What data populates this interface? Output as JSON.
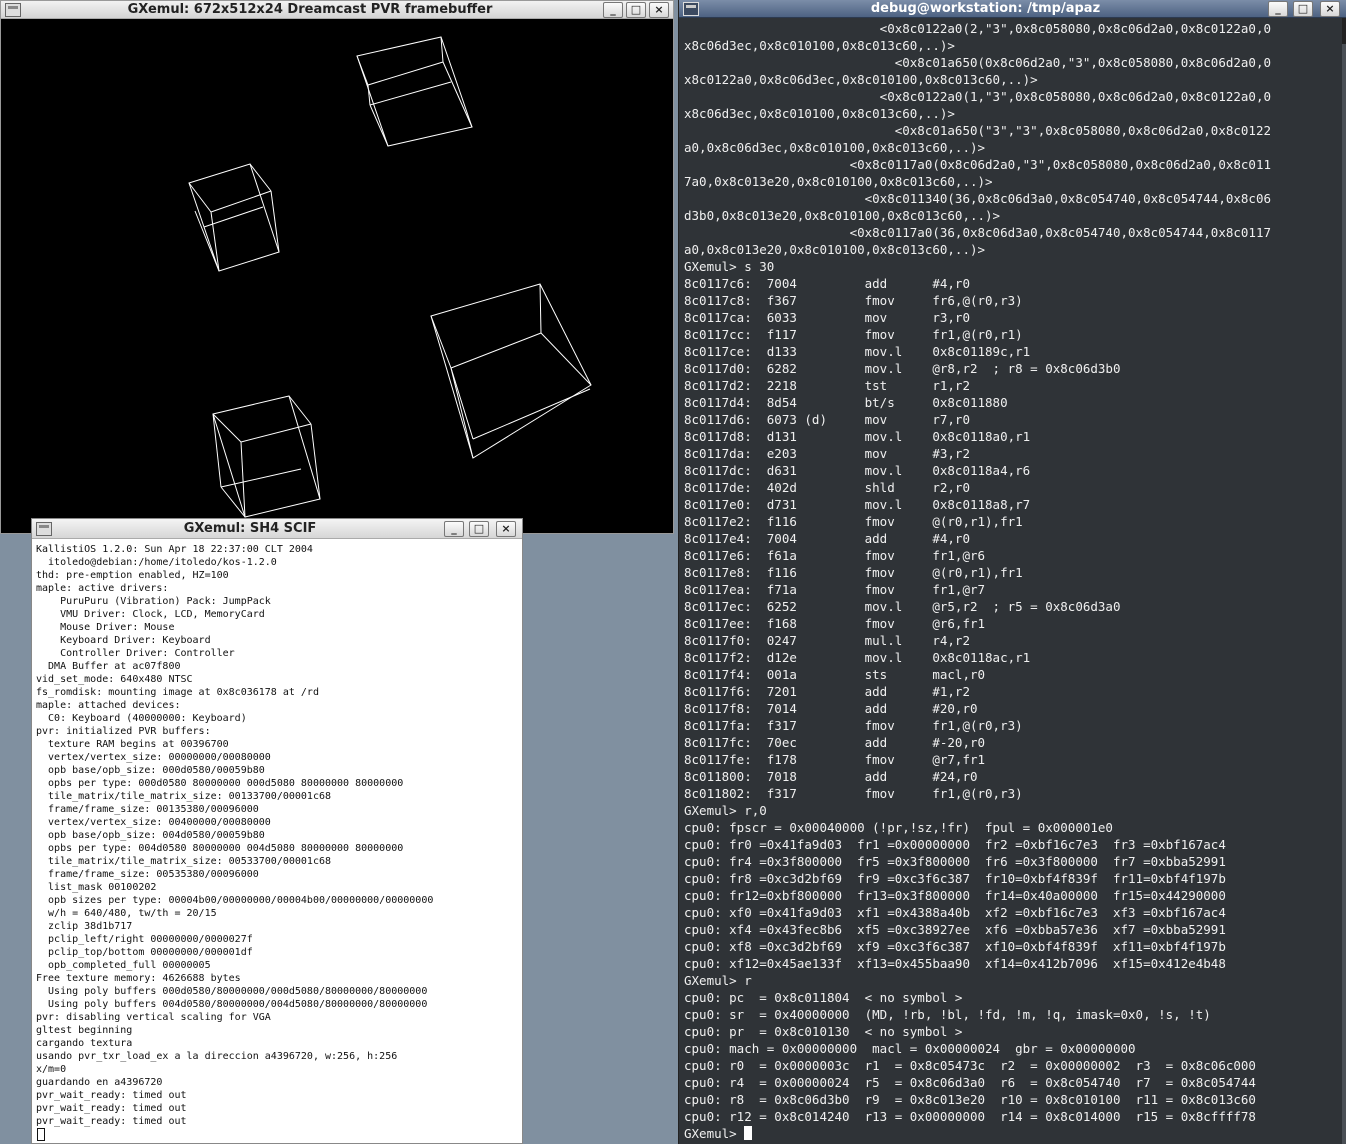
{
  "framebuffer_window": {
    "title": "GXemul: 672x512x24 Dreamcast PVR framebuffer",
    "buttons": {
      "minimize": "_",
      "maximize": "□",
      "close": "×"
    }
  },
  "scif_window": {
    "title": "GXemul:  SH4 SCIF",
    "buttons": {
      "minimize": "_",
      "maximize": "□",
      "close": "×"
    },
    "lines": [
      "KallistiOS 1.2.0: Sun Apr 18 22:37:00 CLT 2004",
      "  itoledo@debian:/home/itoledo/kos-1.2.0",
      "thd: pre-emption enabled, HZ=100",
      "maple: active drivers:",
      "    PuruPuru (Vibration) Pack: JumpPack",
      "    VMU Driver: Clock, LCD, MemoryCard",
      "    Mouse Driver: Mouse",
      "    Keyboard Driver: Keyboard",
      "    Controller Driver: Controller",
      "  DMA Buffer at ac07f800",
      "vid_set_mode: 640x480 NTSC",
      "fs_romdisk: mounting image at 0x8c036178 at /rd",
      "maple: attached devices:",
      "  C0: Keyboard (40000000: Keyboard)",
      "pvr: initialized PVR buffers:",
      "  texture RAM begins at 00396700",
      "  vertex/vertex_size: 00000000/00080000",
      "  opb base/opb_size: 000d0580/00059b80",
      "  opbs per type: 000d0580 80000000 000d5080 80000000 80000000",
      "  tile_matrix/tile_matrix_size: 00133700/00001c68",
      "  frame/frame_size: 00135380/00096000",
      "  vertex/vertex_size: 00400000/00080000",
      "  opb base/opb_size: 004d0580/00059b80",
      "  opbs per type: 004d0580 80000000 004d5080 80000000 80000000",
      "  tile_matrix/tile_matrix_size: 00533700/00001c68",
      "  frame/frame_size: 00535380/00096000",
      "  list_mask 00100202",
      "  opb sizes per type: 00004b00/00000000/00004b00/00000000/00000000",
      "  w/h = 640/480, tw/th = 20/15",
      "  zclip 38d1b717",
      "  pclip_left/right 00000000/0000027f",
      "  pclip_top/bottom 00000000/000001df",
      "  opb_completed_full 00000005",
      "Free texture memory: 4626688 bytes",
      "  Using poly buffers 000d0580/80000000/000d5080/80000000/80000000",
      "  Using poly buffers 004d0580/80000000/004d5080/80000000/80000000",
      "pvr: disabling vertical scaling for VGA",
      "gltest beginning",
      "cargando textura",
      "usando pvr_txr_load_ex a la direccion a4396720, w:256, h:256",
      "x/m=0",
      "guardando en a4396720",
      "pvr_wait_ready: timed out",
      "pvr_wait_ready: timed out",
      "pvr_wait_ready: timed out",
      ""
    ]
  },
  "terminal_window": {
    "title": "debug@workstation: /tmp/apaz",
    "buttons": {
      "minimize": "_",
      "maximize": "□",
      "close": "×"
    },
    "lines": [
      "                          <0x8c0122a0(2,\"3\",0x8c058080,0x8c06d2a0,0x8c0122a0,0",
      "x8c06d3ec,0x8c010100,0x8c013c60,..)>",
      "                            <0x8c01a650(0x8c06d2a0,\"3\",0x8c058080,0x8c06d2a0,0",
      "x8c0122a0,0x8c06d3ec,0x8c010100,0x8c013c60,..)>",
      "                          <0x8c0122a0(1,\"3\",0x8c058080,0x8c06d2a0,0x8c0122a0,0",
      "x8c06d3ec,0x8c010100,0x8c013c60,..)>",
      "                            <0x8c01a650(\"3\",\"3\",0x8c058080,0x8c06d2a0,0x8c0122",
      "a0,0x8c06d3ec,0x8c010100,0x8c013c60,..)>",
      "                      <0x8c0117a0(0x8c06d2a0,\"3\",0x8c058080,0x8c06d2a0,0x8c011",
      "7a0,0x8c013e20,0x8c010100,0x8c013c60,..)>",
      "                        <0x8c011340(36,0x8c06d3a0,0x8c054740,0x8c054744,0x8c06",
      "d3b0,0x8c013e20,0x8c010100,0x8c013c60,..)>",
      "                      <0x8c0117a0(36,0x8c06d3a0,0x8c054740,0x8c054744,0x8c0117",
      "a0,0x8c013e20,0x8c010100,0x8c013c60,..)>",
      "GXemul> s 30",
      "8c0117c6:  7004         add      #4,r0",
      "8c0117c8:  f367         fmov     fr6,@(r0,r3)",
      "8c0117ca:  6033         mov      r3,r0",
      "8c0117cc:  f117         fmov     fr1,@(r0,r1)",
      "8c0117ce:  d133         mov.l    0x8c01189c,r1",
      "8c0117d0:  6282         mov.l    @r8,r2  ; r8 = 0x8c06d3b0",
      "8c0117d2:  2218         tst      r1,r2",
      "8c0117d4:  8d54         bt/s     0x8c011880",
      "8c0117d6:  6073 (d)     mov      r7,r0",
      "8c0117d8:  d131         mov.l    0x8c0118a0,r1",
      "8c0117da:  e203         mov      #3,r2",
      "8c0117dc:  d631         mov.l    0x8c0118a4,r6",
      "8c0117de:  402d         shld     r2,r0",
      "8c0117e0:  d731         mov.l    0x8c0118a8,r7",
      "8c0117e2:  f116         fmov     @(r0,r1),fr1",
      "8c0117e4:  7004         add      #4,r0",
      "8c0117e6:  f61a         fmov     fr1,@r6",
      "8c0117e8:  f116         fmov     @(r0,r1),fr1",
      "8c0117ea:  f71a         fmov     fr1,@r7",
      "8c0117ec:  6252         mov.l    @r5,r2  ; r5 = 0x8c06d3a0",
      "8c0117ee:  f168         fmov     @r6,fr1",
      "8c0117f0:  0247         mul.l    r4,r2",
      "8c0117f2:  d12e         mov.l    0x8c0118ac,r1",
      "8c0117f4:  001a         sts      macl,r0",
      "8c0117f6:  7201         add      #1,r2",
      "8c0117f8:  7014         add      #20,r0",
      "8c0117fa:  f317         fmov     fr1,@(r0,r3)",
      "8c0117fc:  70ec         add      #-20,r0",
      "8c0117fe:  f178         fmov     @r7,fr1",
      "8c011800:  7018         add      #24,r0",
      "8c011802:  f317         fmov     fr1,@(r0,r3)",
      "GXemul> r,0",
      "cpu0: fpscr = 0x00040000 (!pr,!sz,!fr)  fpul = 0x000001e0",
      "cpu0: fr0 =0x41fa9d03  fr1 =0x00000000  fr2 =0xbf16c7e3  fr3 =0xbf167ac4",
      "cpu0: fr4 =0x3f800000  fr5 =0x3f800000  fr6 =0x3f800000  fr7 =0xbba52991",
      "cpu0: fr8 =0xc3d2bf69  fr9 =0xc3f6c387  fr10=0xbf4f839f  fr11=0xbf4f197b",
      "cpu0: fr12=0xbf800000  fr13=0x3f800000  fr14=0x40a00000  fr15=0x44290000",
      "cpu0: xf0 =0x41fa9d03  xf1 =0x4388a40b  xf2 =0xbf16c7e3  xf3 =0xbf167ac4",
      "cpu0: xf4 =0x43fec8b6  xf5 =0xc38927ee  xf6 =0xbba57e36  xf7 =0xbba52991",
      "cpu0: xf8 =0xc3d2bf69  xf9 =0xc3f6c387  xf10=0xbf4f839f  xf11=0xbf4f197b",
      "cpu0: xf12=0x45ae133f  xf13=0x455baa90  xf14=0x412b7096  xf15=0x412e4b48",
      "GXemul> r",
      "cpu0: pc  = 0x8c011804  < no symbol >",
      "cpu0: sr  = 0x40000000  (MD, !rb, !bl, !fd, !m, !q, imask=0x0, !s, !t)",
      "cpu0: pr  = 0x8c010130  < no symbol >",
      "cpu0: mach = 0x00000000  macl = 0x00000024  gbr = 0x00000000",
      "cpu0: r0  = 0x0000003c  r1  = 0x8c05473c  r2  = 0x00000002  r3  = 0x8c06c000",
      "cpu0: r4  = 0x00000024  r5  = 0x8c06d3a0  r6  = 0x8c054740  r7  = 0x8c054744",
      "cpu0: r8  = 0x8c06d3b0  r9  = 0x8c013e20  r10 = 0x8c010100  r11 = 0x8c013c60",
      "cpu0: r12 = 0x8c014240  r13 = 0x00000000  r14 = 0x8c014000  r15 = 0x8cffff78"
    ],
    "prompt": "GXemul> "
  },
  "colors": {
    "desktop": "#8090a0",
    "terminal_bg": "#2f3337",
    "terminal_fg": "#f0f0f0",
    "terminal_title_bg": "#5a6e8c",
    "framebuffer_bg": "#000000",
    "wireframe": "#ffffff"
  },
  "icons": {
    "window_menu": "window-menu-icon",
    "minimize": "minimize-icon",
    "maximize": "maximize-icon",
    "close": "close-icon"
  }
}
